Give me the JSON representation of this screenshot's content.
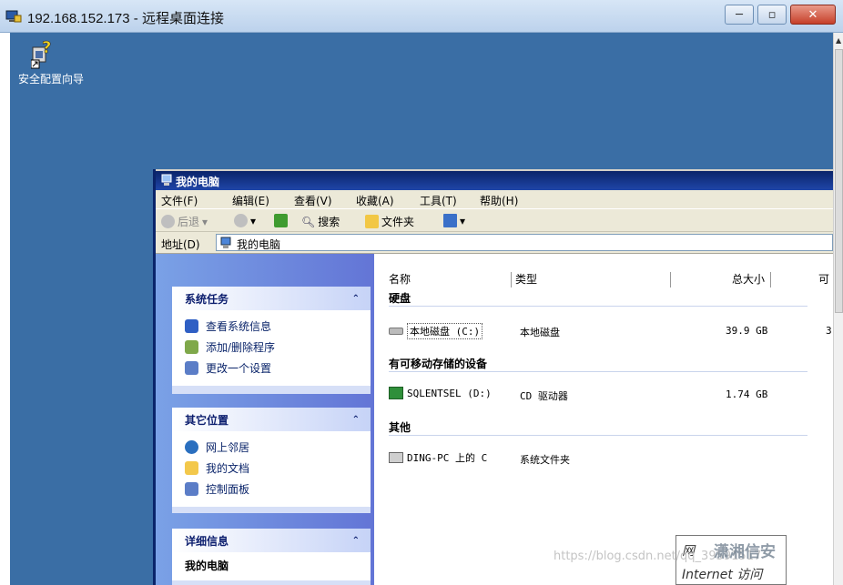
{
  "window": {
    "title": "192.168.152.173 - 远程桌面连接",
    "min": "─",
    "max": "▫",
    "close": "✕"
  },
  "desktop": {
    "icon_label": "安全配置向导"
  },
  "explorer": {
    "title": "我的电脑",
    "menu": [
      "文件(F)",
      "编辑(E)",
      "查看(V)",
      "收藏(A)",
      "工具(T)",
      "帮助(H)"
    ],
    "toolbar": {
      "back": "后退",
      "search": "搜索",
      "folders": "文件夹"
    },
    "address": {
      "label": "地址(D)",
      "value": "我的电脑"
    },
    "panels": [
      {
        "title": "系统任务",
        "items": [
          "查看系统信息",
          "添加/删除程序",
          "更改一个设置"
        ]
      },
      {
        "title": "其它位置",
        "items": [
          "网上邻居",
          "我的文档",
          "控制面板"
        ]
      },
      {
        "title": "详细信息",
        "items": [
          "我的电脑"
        ]
      }
    ],
    "columns": [
      "名称",
      "类型",
      "总大小",
      "可"
    ],
    "groups": [
      "硬盘",
      "有可移动存储的设备",
      "其他"
    ],
    "rows": [
      {
        "name": "本地磁盘 (C:)",
        "type": "本地磁盘",
        "size": "39.9 GB",
        "extra": "3"
      },
      {
        "name": "SQLENTSEL (D:)",
        "type": "CD 驱动器",
        "size": "1.74 GB",
        "extra": ""
      },
      {
        "name": "DING-PC 上的 C",
        "type": "系统文件夹",
        "size": "",
        "extra": ""
      }
    ]
  },
  "overlay": {
    "line1": "网",
    "line2": "Internet 访问"
  },
  "watermark": {
    "brand": "潇湘信安",
    "url": "https://blog.csdn.net/qq_39591517"
  },
  "colors": {
    "desktop": "#3a6ea5",
    "titlebar": "#0a246a",
    "accent": "#6375d6"
  }
}
